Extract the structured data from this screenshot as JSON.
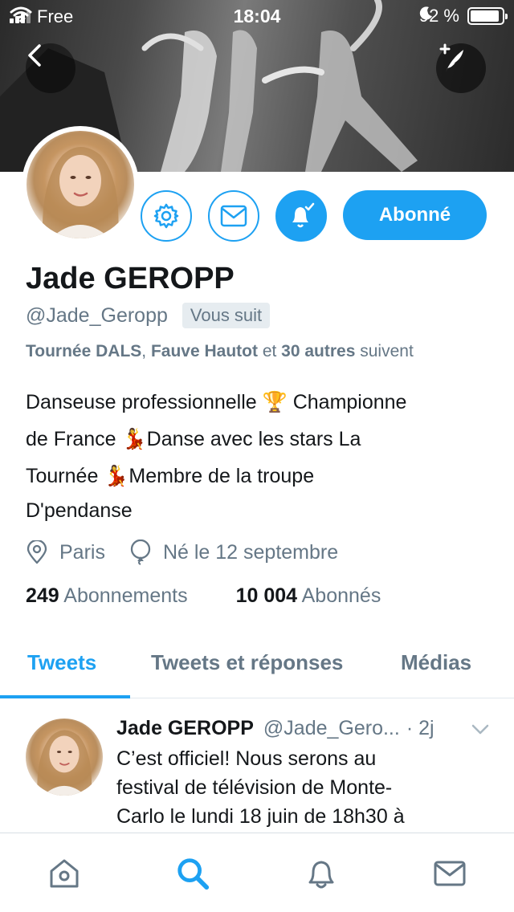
{
  "status_bar": {
    "carrier": "Free",
    "time": "18:04",
    "battery": "92 %",
    "battery_level": 0.92
  },
  "profile": {
    "name": "Jade GEROPP",
    "handle": "@Jade_Geropp",
    "follows_you": "Vous suit",
    "follow_button": "Abonné",
    "followed_by": {
      "name1": "Tournée DALS",
      "sep": ", ",
      "name2": "Fauve Hautot",
      "and": " et ",
      "others": "30 autres",
      "suffix": " suivent"
    },
    "bio_lines": [
      "Danseuse professionnelle 🏆 Championne",
      "de France 💃Danse avec les stars La",
      "Tournée 💃Membre de la troupe",
      "D'pendanse"
    ],
    "location": "Paris",
    "birthday": "Né le 12 septembre",
    "following_count": "249",
    "following_label": "Abonnements",
    "followers_count": "10 004",
    "followers_label": "Abonnés"
  },
  "tabs": [
    {
      "label": "Tweets",
      "active": true
    },
    {
      "label": "Tweets et réponses",
      "active": false
    },
    {
      "label": "Médias",
      "active": false
    }
  ],
  "tweet": {
    "name": "Jade GEROPP",
    "handle": "@Jade_Gero...",
    "time": "· 2j",
    "lines": [
      "C’est officiel! Nous serons au",
      "festival de télévision de Monte-",
      "Carlo le lundi 18 juin de 18h30 à"
    ]
  },
  "icons": {
    "back": "chevron-left-icon",
    "compose": "quill-plus-icon",
    "settings": "gear-icon",
    "message": "envelope-icon",
    "notifications": "bell-check-icon",
    "location": "map-pin-icon",
    "birthday": "balloon-icon",
    "nav": [
      "home-icon",
      "search-icon",
      "bell-icon",
      "envelope-icon"
    ]
  },
  "colors": {
    "accent": "#1da1f2",
    "secondary_text": "#657786",
    "primary_text": "#14171a"
  }
}
